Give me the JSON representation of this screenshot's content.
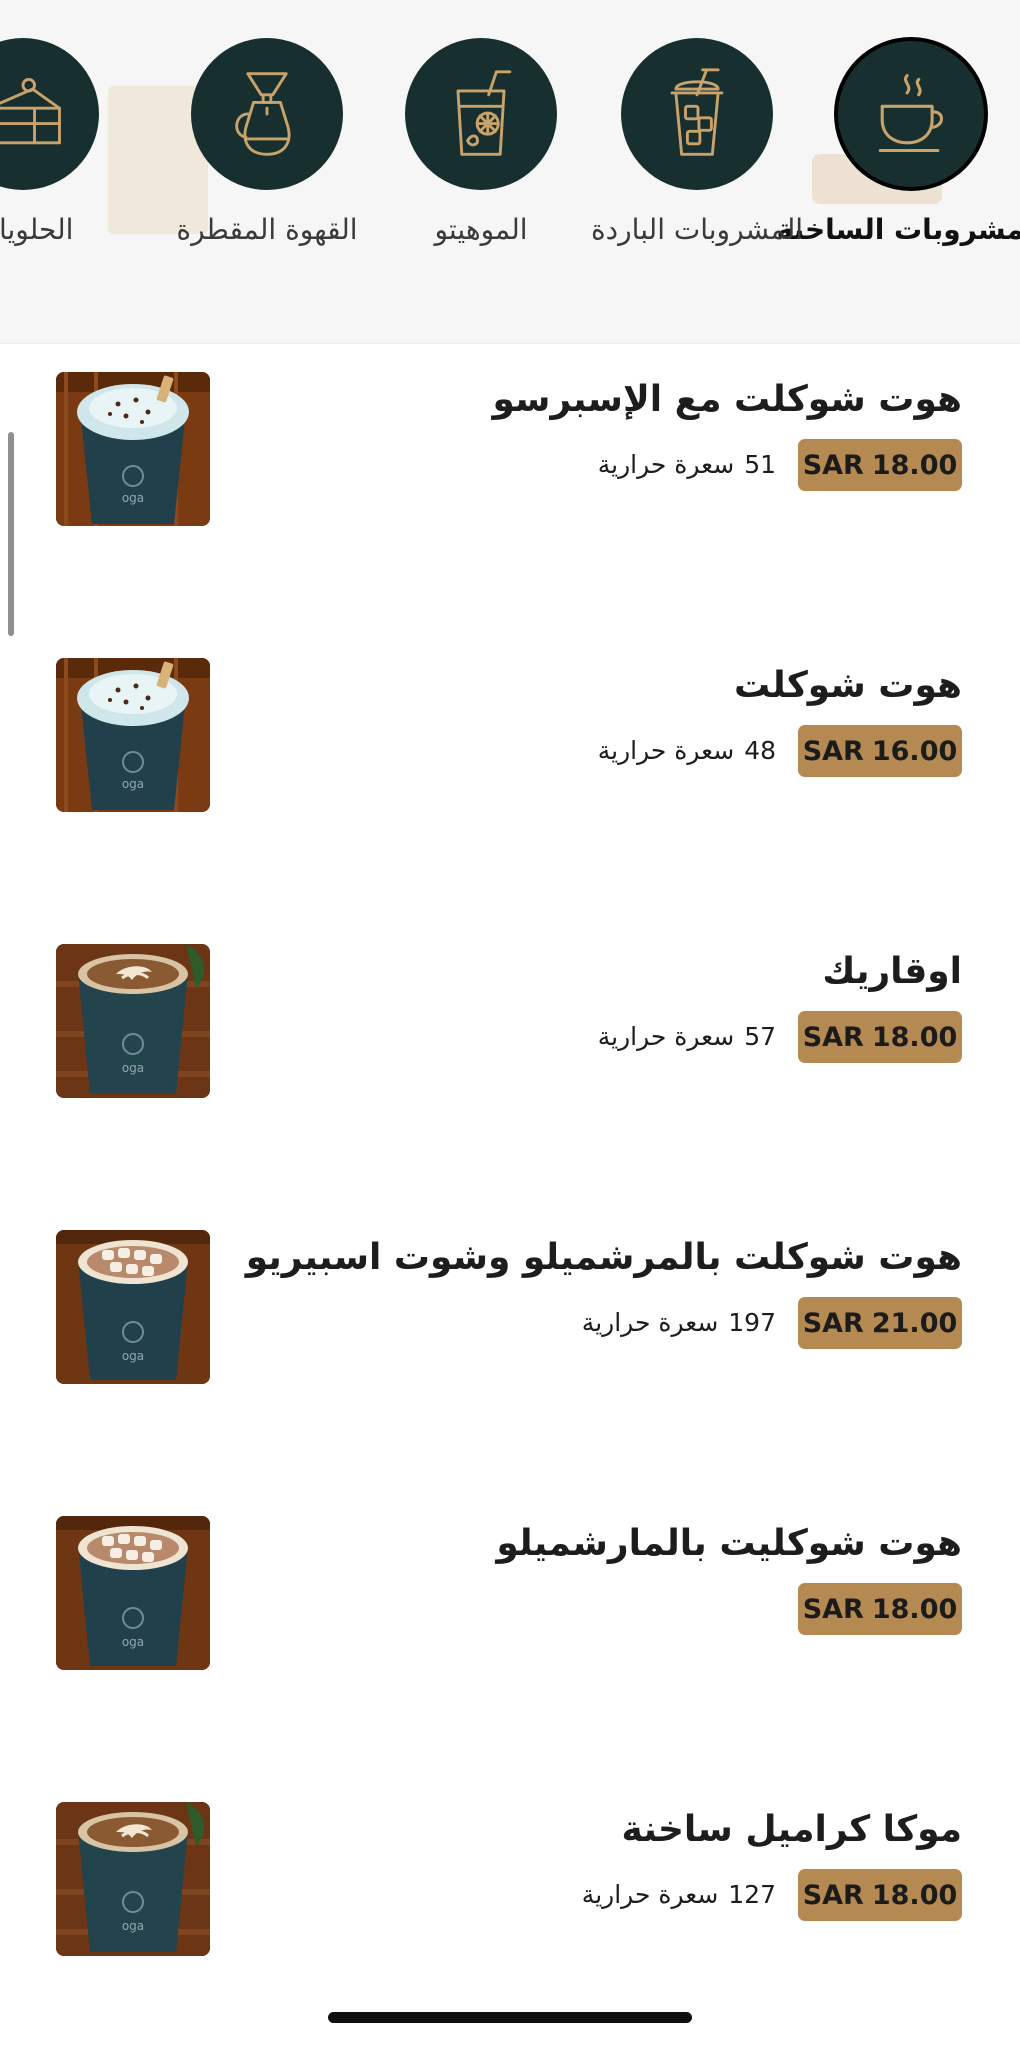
{
  "colors": {
    "category_bg": "#17302f",
    "category_icon": "#c9a36b",
    "price_badge": "#b48a52"
  },
  "categories": [
    {
      "label": "المشروبات الساخنة",
      "icon": "hot-cup-icon",
      "active": true
    },
    {
      "label": "المشروبات الباردة",
      "icon": "iced-drink-icon",
      "active": false
    },
    {
      "label": "الموهيتو",
      "icon": "mojito-glass-icon",
      "active": false
    },
    {
      "label": "القهوة المقطرة",
      "icon": "drip-coffee-icon",
      "active": false
    },
    {
      "label": "الحلويات",
      "icon": "cake-slice-icon",
      "active": false
    }
  ],
  "items": [
    {
      "name": "هوت شوكلت مع الإسبرسو",
      "currency": "SAR",
      "price": "18.00",
      "calories": "51",
      "calories_label": "سعرة حرارية",
      "image": "whipped-cream-cup"
    },
    {
      "name": "هوت شوكلت",
      "currency": "SAR",
      "price": "16.00",
      "calories": "48",
      "calories_label": "سعرة حرارية",
      "image": "whipped-cream-cup"
    },
    {
      "name": "اوقاريك",
      "currency": "SAR",
      "price": "18.00",
      "calories": "57",
      "calories_label": "سعرة حرارية",
      "image": "latte-art-cup"
    },
    {
      "name": "هوت شوكلت بالمرشميلو وشوت اسبيريو",
      "currency": "SAR",
      "price": "21.00",
      "calories": "197",
      "calories_label": "سعرة حرارية",
      "image": "marshmallow-cup"
    },
    {
      "name": "هوت شوكليت بالمارشميلو",
      "currency": "SAR",
      "price": "18.00",
      "calories": "",
      "calories_label": "",
      "image": "marshmallow-cup"
    },
    {
      "name": "موكا كراميل ساخنة",
      "currency": "SAR",
      "price": "18.00",
      "calories": "127",
      "calories_label": "سعرة حرارية",
      "image": "latte-art-cup"
    }
  ]
}
